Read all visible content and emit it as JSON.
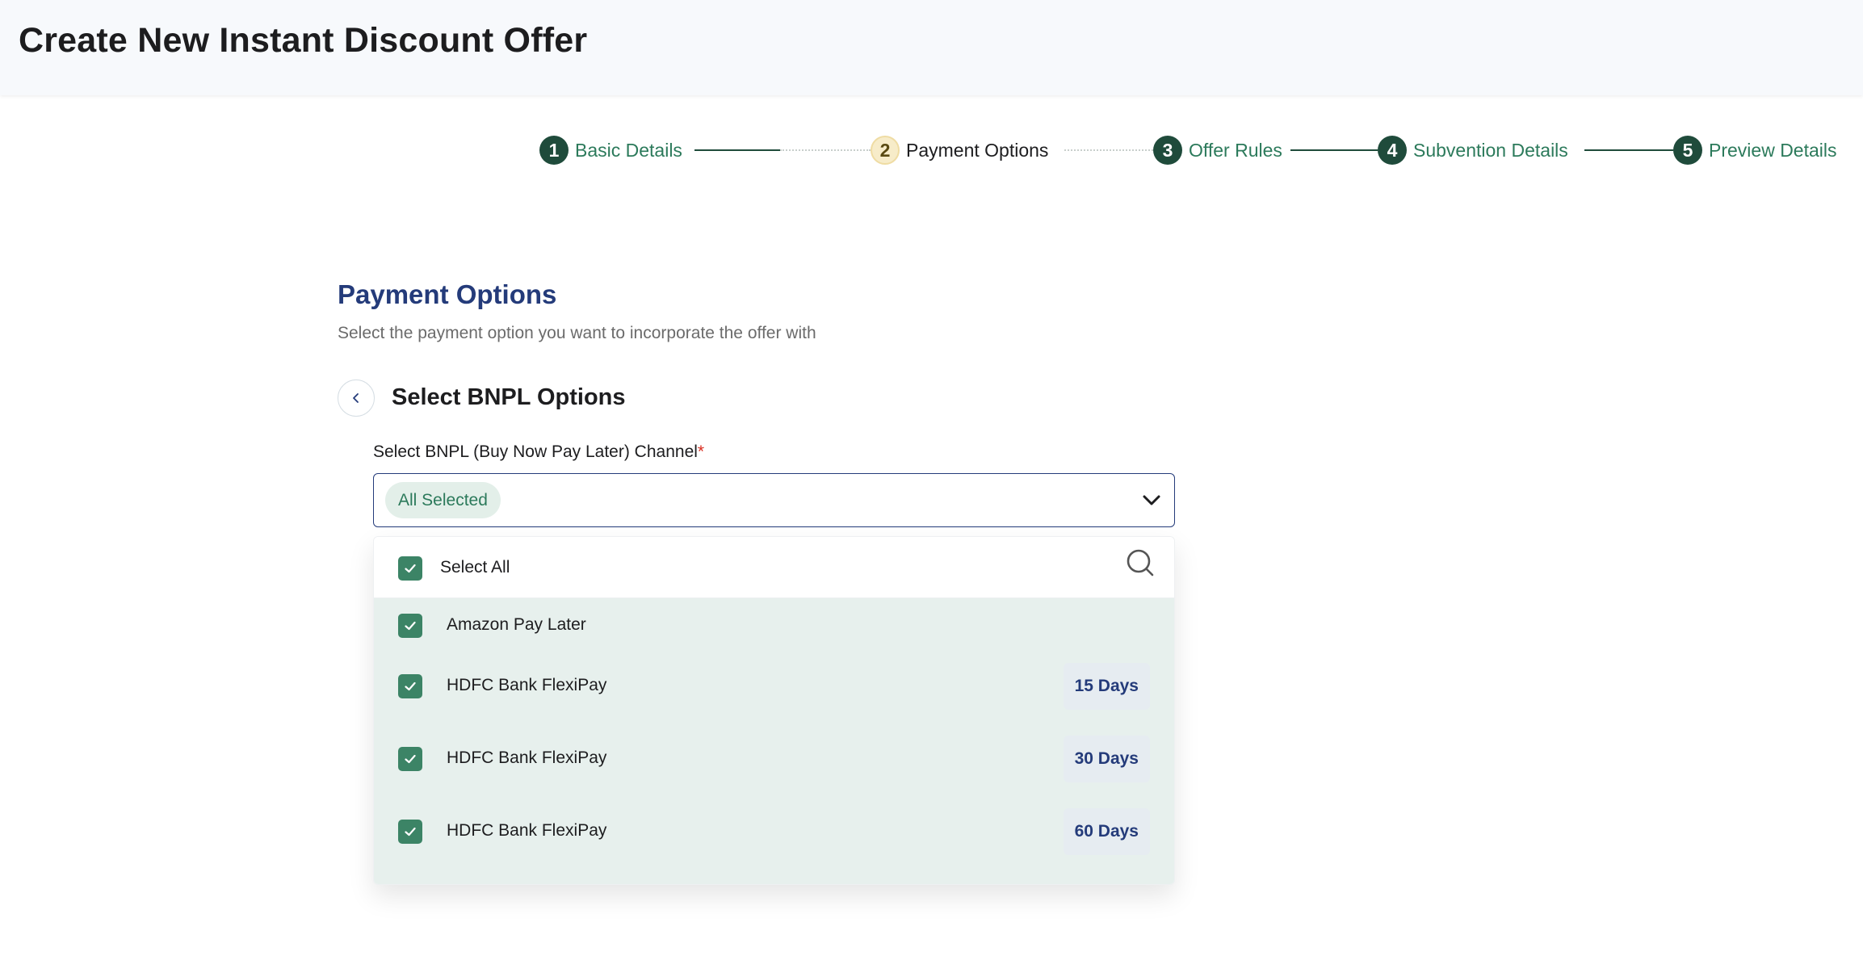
{
  "header": {
    "title": "Create New Instant Discount Offer"
  },
  "stepper": {
    "steps": [
      {
        "number": "1",
        "label": "Basic Details"
      },
      {
        "number": "2",
        "label": "Payment Options"
      },
      {
        "number": "3",
        "label": "Offer Rules"
      },
      {
        "number": "4",
        "label": "Subvention Details"
      },
      {
        "number": "5",
        "label": "Preview Details"
      }
    ],
    "active_step": 2
  },
  "section": {
    "title": "Payment Options",
    "subtitle": "Select the payment option you want to incorporate the offer with"
  },
  "subsection": {
    "title": "Select BNPL Options"
  },
  "channel_field": {
    "label": "Select BNPL (Buy Now Pay Later) Channel",
    "required_mark": "*",
    "selected_chip": "All Selected"
  },
  "dropdown": {
    "select_all_label": "Select All",
    "select_all_checked": true,
    "options": [
      {
        "label": "Amazon Pay Later",
        "badge": "",
        "checked": true
      },
      {
        "label": "HDFC Bank FlexiPay",
        "badge": "15 Days",
        "checked": true
      },
      {
        "label": "HDFC Bank FlexiPay",
        "badge": "30 Days",
        "checked": true
      },
      {
        "label": "HDFC Bank FlexiPay",
        "badge": "60 Days",
        "checked": true
      }
    ]
  },
  "colors": {
    "brand_green": "#1f4b3b",
    "accent_green": "#2c7a5b",
    "checkbox_green": "#3c8466",
    "navy": "#243b7a",
    "required_red": "#d92d20"
  }
}
